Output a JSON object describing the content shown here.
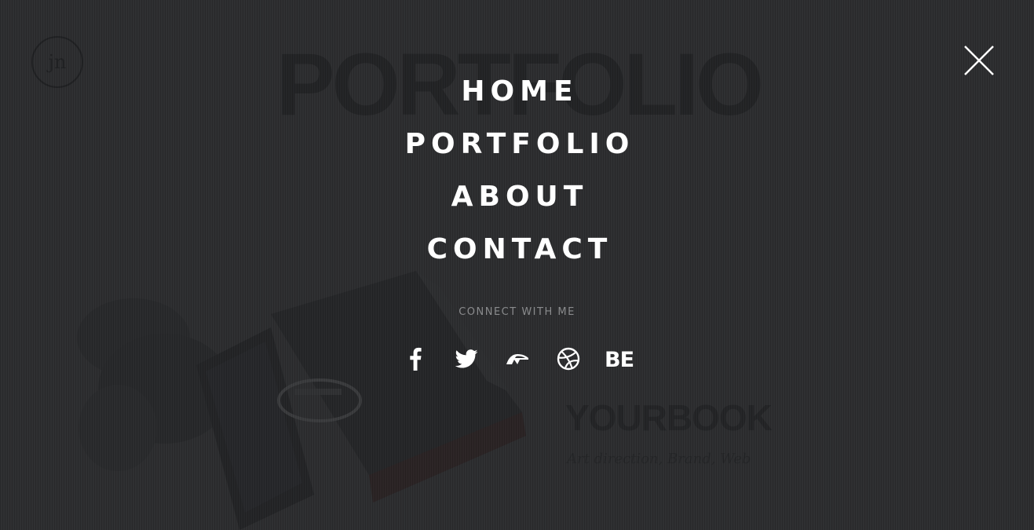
{
  "background": {
    "logo_text": "jn",
    "page_title": "PORTFOLIO",
    "project_title": "YOURBOOK",
    "project_subtitle": "Art direction, Brand, Web"
  },
  "menu": {
    "items": [
      {
        "label": "HOME"
      },
      {
        "label": "PORTFOLIO"
      },
      {
        "label": "ABOUT"
      },
      {
        "label": "CONTACT"
      }
    ],
    "connect_label": "CONNECT WITH ME",
    "social": [
      {
        "icon": "facebook-icon"
      },
      {
        "icon": "twitter-icon"
      },
      {
        "icon": "deviantart-icon"
      },
      {
        "icon": "dribbble-icon"
      },
      {
        "icon": "behance-icon",
        "label": "BE"
      }
    ],
    "close_icon": "close-icon"
  },
  "colors": {
    "overlay": "#2c2d2f",
    "text": "#ffffff",
    "muted": "#8a8b8d"
  }
}
